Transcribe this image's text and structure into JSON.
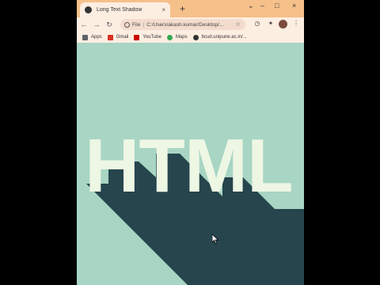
{
  "browser": {
    "tab_title": "Long Text Shadow",
    "tab_close": "×",
    "new_tab": "+",
    "window_controls": [
      "–",
      "□",
      "×"
    ]
  },
  "toolbar": {
    "back": "←",
    "forward": "→",
    "reload": "C",
    "scheme_label": "File",
    "url": "C:/Users/akash.kumar/Desktop/...",
    "star": "☆"
  },
  "bookmarks": [
    {
      "label": "Apps",
      "icon": "apps-grid-icon",
      "color": "#5f6368"
    },
    {
      "label": "Gmail",
      "icon": "gmail-icon",
      "color": "#d93025"
    },
    {
      "label": "YouTube",
      "icon": "youtube-icon",
      "color": "#cc0000"
    },
    {
      "label": "Maps",
      "icon": "maps-pin-icon",
      "color": "#34a853"
    },
    {
      "label": "bcud.unipune.ac.in/...",
      "icon": "globe-icon",
      "color": "#333333"
    }
  ],
  "page": {
    "heading": "HTML",
    "background_color": "#a8d5c4",
    "text_color": "#eef6e4",
    "shadow_color": "#26454d"
  }
}
